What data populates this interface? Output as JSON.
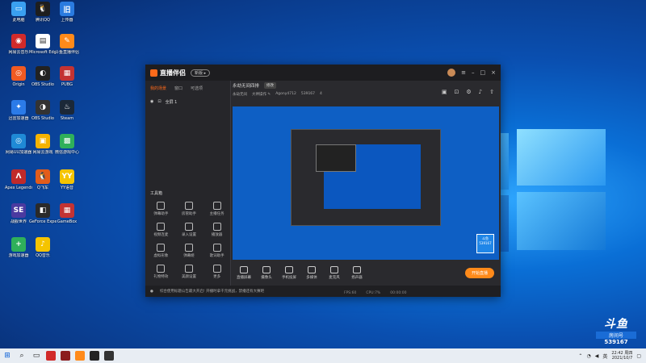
{
  "desktop": {
    "icons": [
      {
        "label": "此电脑",
        "color": "#3aa0f0",
        "glyph": "▭"
      },
      {
        "label": "腾讯QQ",
        "color": "#1e1e1e",
        "glyph": "🐧"
      },
      {
        "label": "上传器",
        "color": "#2a7be0",
        "glyph": "旧"
      },
      {
        "label": "网易云音乐",
        "color": "#d12a2a",
        "glyph": "◉"
      },
      {
        "label": "Microsoft Edge",
        "color": "#ffffff",
        "glyph": "▤"
      },
      {
        "label": "斗鱼直播伴侣",
        "color": "#ff8a1a",
        "glyph": "✎"
      },
      {
        "label": "Origin",
        "color": "#f05a22",
        "glyph": "◎"
      },
      {
        "label": "OBS Studio",
        "color": "#222222",
        "glyph": "◐"
      },
      {
        "label": "PUBG",
        "color": "#c33333",
        "glyph": "▦"
      },
      {
        "label": "迅雷加速器",
        "color": "#2b7be8",
        "glyph": "✦"
      },
      {
        "label": "OBS Studio",
        "color": "#333333",
        "glyph": "◑"
      },
      {
        "label": "Steam",
        "color": "#1b2838",
        "glyph": "♨"
      },
      {
        "label": "网易UU加速器",
        "color": "#1f8ad6",
        "glyph": "◎"
      },
      {
        "label": "网易云游戏",
        "color": "#f5b300",
        "glyph": "▣"
      },
      {
        "label": "微信游戏中心",
        "color": "#2fb05a",
        "glyph": "▩"
      },
      {
        "label": "Apex Legends",
        "color": "#c02a2a",
        "glyph": "Λ"
      },
      {
        "label": "Q飞车",
        "color": "#e25c1a",
        "glyph": "🐧"
      },
      {
        "label": "YY语音",
        "color": "#f5c400",
        "glyph": "YY"
      },
      {
        "label": "战舰世界",
        "color": "#4b3aa0",
        "glyph": "SE"
      },
      {
        "label": "GeForce Experience",
        "color": "#2a2a2a",
        "glyph": "◧"
      },
      {
        "label": "GameBox",
        "color": "#c33333",
        "glyph": "▦"
      },
      {
        "label": "游戏加速器",
        "color": "#2fb05a",
        "glyph": "+"
      },
      {
        "label": "QQ音乐",
        "color": "#f5c400",
        "glyph": "♪"
      }
    ]
  },
  "app": {
    "title": "直播伴侣",
    "version_badge": "新版 ▸",
    "left_tabs": [
      "我的场景",
      "窗口",
      "可选项"
    ],
    "scene_label": "全屏 1",
    "tools_title": "工具箱",
    "tools": [
      {
        "label": "弹幕助手"
      },
      {
        "label": "房管助手"
      },
      {
        "label": "主播任务"
      },
      {
        "label": "视频连麦"
      },
      {
        "label": "录入设置"
      },
      {
        "label": "播放器"
      },
      {
        "label": "虚拟形象"
      },
      {
        "label": "弹幕姬"
      },
      {
        "label": "歌词助手"
      },
      {
        "label": "礼物特效"
      },
      {
        "label": "美颜设置"
      },
      {
        "label": "更多"
      }
    ],
    "room_title": "永劫无间四排",
    "room_tag": "修改",
    "room_meta": [
      "永劫无间",
      "大神操作 ✎",
      "Agony4712",
      "539167",
      "4"
    ],
    "preview_badge": [
      "斗鱼",
      "539167"
    ],
    "bottom_tools": [
      "直播屏幕",
      "摄像头",
      "手机投屏",
      "多媒体",
      "麦克风",
      "扬声器"
    ],
    "live_button": "开始直播",
    "notice": "综合使用标题公告最大开启! 开播时拿千元挑战，禁播还有大赛吧",
    "status": [
      "FPS:60",
      "CPU:7%",
      "00:00:00"
    ]
  },
  "watermark": {
    "logo": "斗鱼",
    "sub": "房间号",
    "number": "539167"
  },
  "taskbar": {
    "time": "22:42 周四",
    "date": "2021/10/7"
  }
}
